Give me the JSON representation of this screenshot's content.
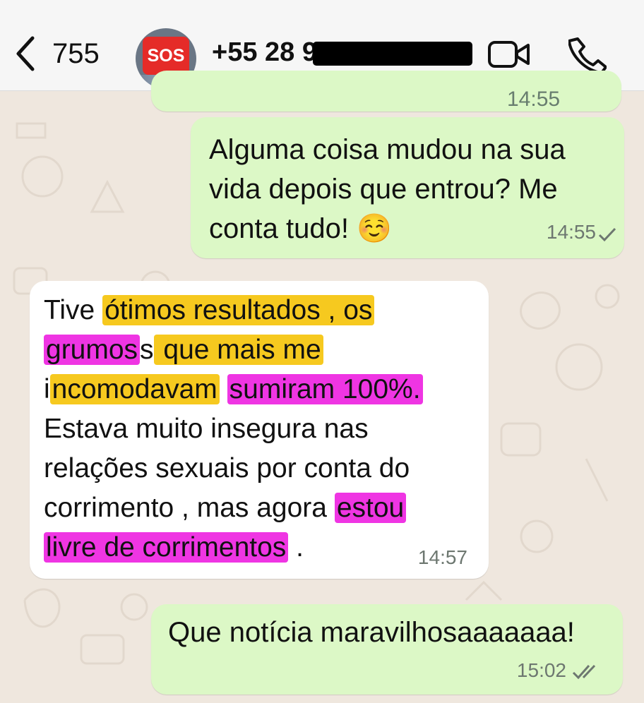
{
  "header": {
    "back_count": "755",
    "avatar_badge": "SOS",
    "contact_phone": "+55 28 9"
  },
  "messages": {
    "partial_time": "14:55",
    "m1": {
      "text": "Alguma coisa mudou na sua vida depois que entrou? Me conta tudo! ☺️",
      "time": "14:55"
    },
    "m2": {
      "lines": [
        [
          "Tive ",
          "ótimos resultados , os"
        ],
        [
          "grumos",
          "s",
          " que mais me"
        ],
        [
          "i",
          "ncomodavam",
          " ",
          "sumiram 100%."
        ],
        [
          "Estava muito insegura nas"
        ],
        [
          "relações sexuais por conta do"
        ],
        [
          "corrimento  , mas agora ",
          "estou"
        ],
        [
          "livre de corrimentos",
          " ."
        ]
      ],
      "time": "14:57"
    },
    "m3": {
      "text": "Que notícia maravilhosaaaaaaa!",
      "time": "15:02"
    }
  },
  "colors": {
    "outgoing_bubble": "#dcf8c6",
    "incoming_bubble": "#ffffff",
    "highlight_yellow": "#f6c91f",
    "highlight_magenta": "#ef35e3"
  }
}
